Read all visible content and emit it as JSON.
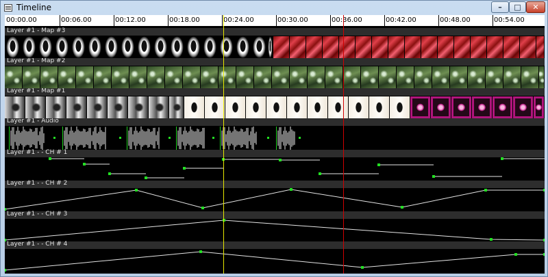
{
  "window": {
    "title": "Timeline",
    "controls": {
      "minimize": "–",
      "maximize": "□",
      "close": "✕"
    }
  },
  "ruler": {
    "labels": [
      "00:00.00",
      "00:06.00",
      "00:12.00",
      "00:18.00",
      "00:24.00",
      "00:30.00",
      "00:36.00",
      "00:42.00",
      "00:48.00",
      "00:54.00"
    ]
  },
  "tracks": [
    {
      "label": "Layer #1 - Map #3",
      "type": "video"
    },
    {
      "label": "Layer #1 - Map #2",
      "type": "video"
    },
    {
      "label": "Layer #1 - Map #1",
      "type": "video"
    },
    {
      "label": "Layer #1 - Audio",
      "type": "audio"
    },
    {
      "label": "Layer #1 -  - CH # 1",
      "type": "channel-step"
    },
    {
      "label": "Layer #1 -  - CH # 2",
      "type": "channel-curve"
    },
    {
      "label": "Layer #1 -  - CH # 3",
      "type": "channel-curve"
    },
    {
      "label": "Layer #1 -  - CH # 4",
      "type": "channel-curve"
    }
  ],
  "colors": {
    "cursor": "#e8e800",
    "marker": "#d00000",
    "keyframe": "#22e022",
    "curve": "#e6e6e6"
  },
  "icons": {
    "app": "timeline-window-icon"
  }
}
